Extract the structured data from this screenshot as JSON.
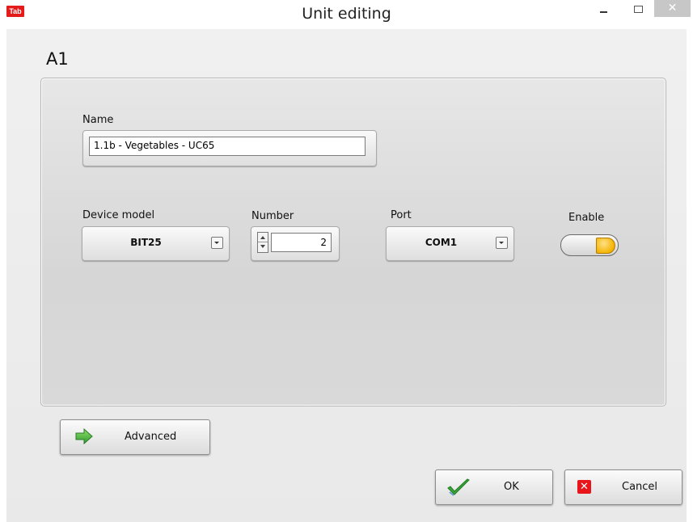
{
  "window": {
    "title": "Unit editing",
    "app_icon_text": "Tab",
    "close_glyph": "✕"
  },
  "unit": {
    "label": "A1"
  },
  "form": {
    "name_label": "Name",
    "name_value": "1.1b - Vegetables - UC65",
    "device_model_label": "Device model",
    "device_model_value": "BIT25",
    "number_label": "Number",
    "number_value": "2",
    "port_label": "Port",
    "port_value": "COM1",
    "enable_label": "Enable",
    "enable_state": true
  },
  "buttons": {
    "advanced": "Advanced",
    "ok": "OK",
    "cancel": "Cancel"
  },
  "colors": {
    "accent_toggle": "#f5b400",
    "close_red": "#e8151b",
    "check_green": "#3aa63a"
  },
  "icons": [
    "app-icon",
    "minimize-icon",
    "maximize-icon",
    "close-icon",
    "arrow-right-icon",
    "check-icon",
    "cancel-x-icon",
    "chevron-down-icon",
    "stepper-icon"
  ]
}
